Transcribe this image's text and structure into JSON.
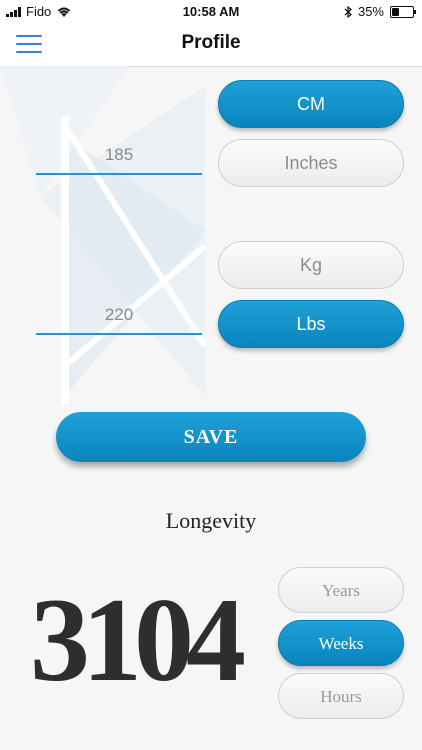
{
  "status_bar": {
    "carrier": "Fido",
    "time": "10:58 AM",
    "battery": "35%",
    "battery_level": 0.35
  },
  "nav": {
    "title": "Profile",
    "menu_icon": "hamburger-menu-icon"
  },
  "height": {
    "value": "185",
    "units": [
      "CM",
      "Inches"
    ],
    "selected": "CM"
  },
  "weight": {
    "value": "220",
    "units": [
      "Kg",
      "Lbs"
    ],
    "selected": "Lbs"
  },
  "save_label": "SAVE",
  "longevity": {
    "label": "Longevity",
    "value": "3104",
    "periods": [
      "Years",
      "Weeks",
      "Hours"
    ],
    "selected": "Weeks"
  },
  "colors": {
    "accent": "#1a95cf",
    "text_dark": "#2e2e2e",
    "menu_icon": "#3a7bd5"
  }
}
